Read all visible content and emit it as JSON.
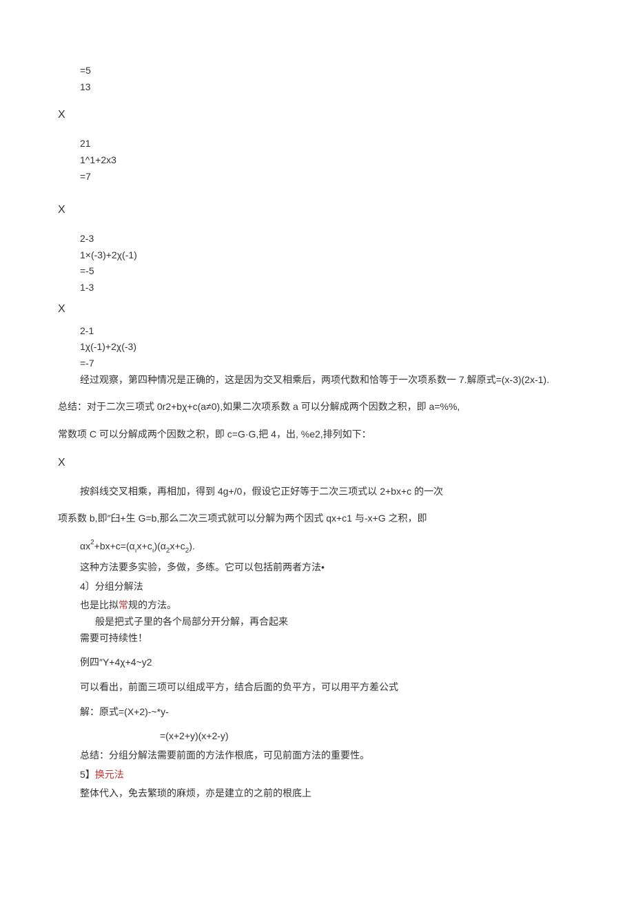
{
  "lines": {
    "l1": "=5",
    "l2": "13",
    "x1": "X",
    "l3": "21",
    "l4": "1^1+2x3",
    "l5": "=7",
    "x2": "X",
    "l6": "2-3",
    "l7": "1×(-3)+2χ(-1)",
    "l8": "=-5",
    "l9": "1-3",
    "x3": "X",
    "l10": "2-1",
    "l11": "1χ(-1)+2χ(-3)",
    "l12": "=-7",
    "l13": "经过观察，第四种情况是正确的，这是因为交叉相乘后，两项代数和恰等于一次项系数一 7.解原式=(x-3)(2x-1).",
    "p1": "总结：对于二次三项式 0r2+bχ+c(a≠0),如果二次项系数 a 可以分解成两个因数之积，即 a=%%,",
    "p2": "常数项 C 可以分解成两个因数之积，即 c=G·G,把 4，出, %e2,排列如下：",
    "x4": "X",
    "p3": "按斜线交叉相乘，再相加，得到 4g+/0，假设它正好等于二次三项式以 2+bx+c 的一次",
    "p4": "项系数 b,即″臼+生 G=b,那么二次三项式就可以分解为两个因式 qx+c1 与-x+G 之积，即",
    "f1a": "αx",
    "f1b": "2",
    "f1c": "+bx+c=(α",
    "f1d": "ı",
    "f1e": "x+c",
    "f1f": "ı",
    "f1g": ")(α",
    "f1h": "2",
    "f1i": "x+c",
    "f1j": "2",
    "f1k": ").",
    "p5": "这种方法要多实验，多做，多练。它可以包括前两者方法•",
    "p6": "4〕分组分解法",
    "p7_pre": "也是比拟",
    "p7_red": "常",
    "p7_post": "规的方法。",
    "p8": "般是把式子里的各个局部分开分解，再合起来",
    "p9": "需要可持续性！",
    "p10": "例四″Y+4χ+4~y2",
    "p11": "可以看出，前面三项可以组成平方，结合后面的负平方，可以用平方差公式",
    "p12": "解：原式=(X+2)-~*y-",
    "p13": "=(x+2+y)(x+2-y)",
    "p14": "总结：分组分解法需要前面的方法作根底，可见前面方法的重要性。",
    "p15_a": "5】",
    "p15_b": "换元法",
    "p16": "整体代入，免去繁琐的麻烦，亦是建立的之前的根底上"
  }
}
